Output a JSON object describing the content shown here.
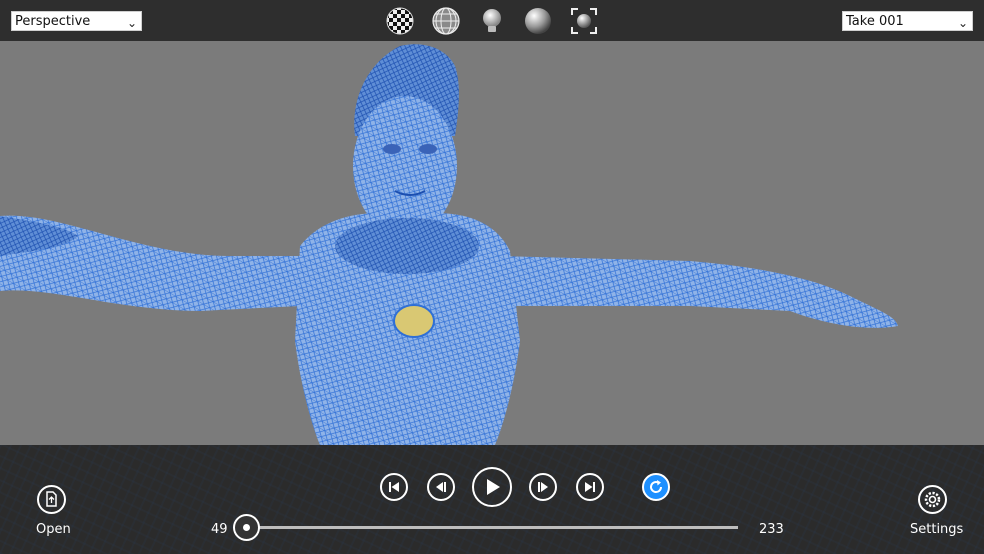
{
  "toolbar": {
    "view_mode": "Perspective",
    "take": "Take 001",
    "tools": [
      {
        "icon": "checker-sphere-icon"
      },
      {
        "icon": "wireframe-sphere-icon"
      },
      {
        "icon": "light-bulb-icon"
      },
      {
        "icon": "shaded-sphere-icon"
      },
      {
        "icon": "fit-view-icon"
      }
    ]
  },
  "playback": {
    "open_label": "Open",
    "settings_label": "Settings",
    "start_frame": "49",
    "end_frame": "233",
    "current_progress": 0.0,
    "loop_color": "#1e90ff"
  }
}
